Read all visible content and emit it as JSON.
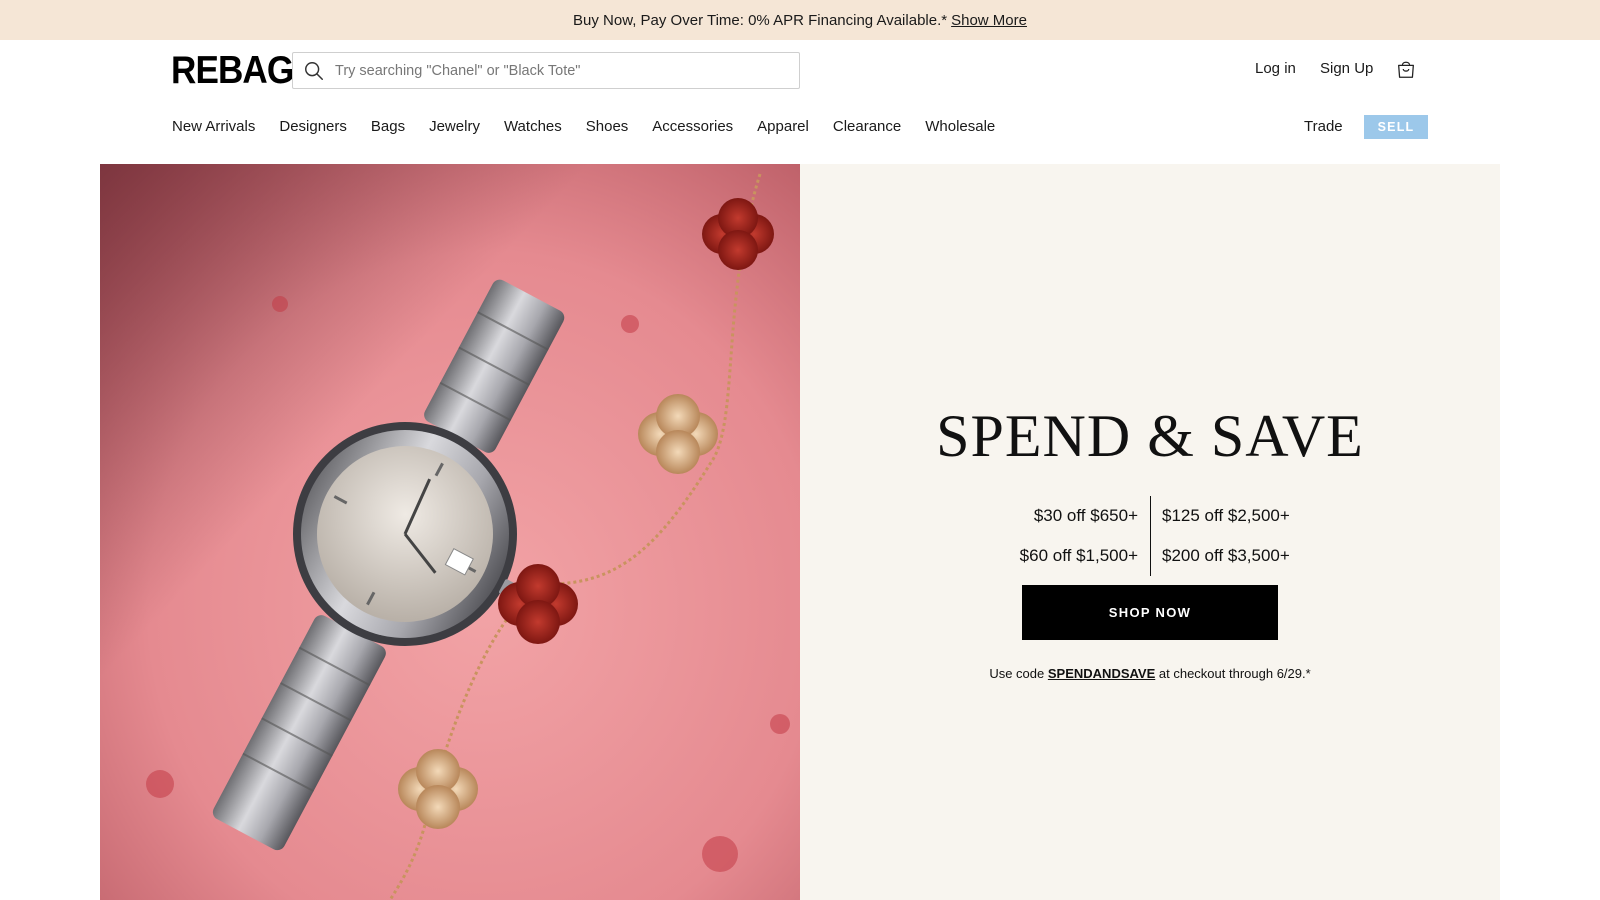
{
  "promo": {
    "text": "Buy Now, Pay Over Time: 0% APR Financing Available.*",
    "link": "Show More"
  },
  "header": {
    "logo": "REBAG",
    "search_placeholder": "Try searching \"Chanel\" or \"Black Tote\"",
    "login": "Log in",
    "signup": "Sign Up",
    "nav": [
      "New Arrivals",
      "Designers",
      "Bags",
      "Jewelry",
      "Watches",
      "Shoes",
      "Accessories",
      "Apparel",
      "Clearance",
      "Wholesale"
    ],
    "trade": "Trade",
    "sell": "SELL",
    "sell_color": "#9cc8ea"
  },
  "hero": {
    "headline": "SPEND & SAVE",
    "tiers": {
      "left": [
        "$30 off $650+",
        "$60 off $1,500+"
      ],
      "right": [
        "$125 off $2,500+",
        "$200 off $3,500+"
      ]
    },
    "cta": "SHOP NOW",
    "code_prefix": "Use code",
    "code": "SPENDANDSAVE",
    "code_suffix": "at checkout through 6/29.*",
    "image_icon": "watch-and-bracelet-photo",
    "panel_color": "#f8f5ef"
  }
}
